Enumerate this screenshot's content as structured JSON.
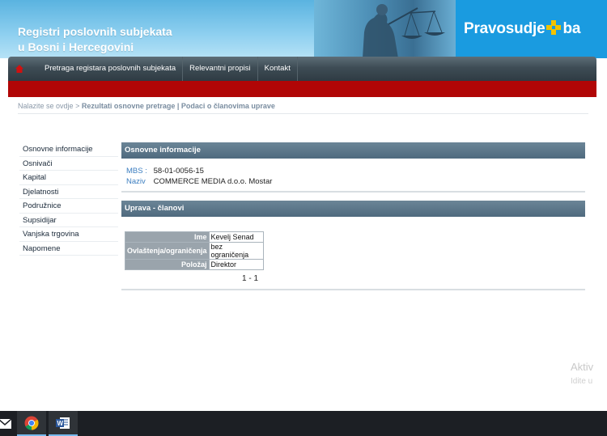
{
  "header": {
    "title_line1": "Registri poslovnih subjekata",
    "title_line2": "u Bosni i Hercegovini",
    "logo_left": "Pravosudje",
    "logo_right": "ba"
  },
  "nav": {
    "items": [
      {
        "label": "Pretraga registara poslovnih subjekata"
      },
      {
        "label": "Relevantni propisi"
      },
      {
        "label": "Kontakt"
      }
    ]
  },
  "breadcrumb": {
    "prefix": "Nalazite se ovdje",
    "separator": ">",
    "current": "Rezultati osnovne pretrage | Podaci o članovima uprave"
  },
  "sidebar": {
    "items": [
      {
        "label": "Osnovne informacije"
      },
      {
        "label": "Osnivači"
      },
      {
        "label": "Kapital"
      },
      {
        "label": "Djelatnosti"
      },
      {
        "label": "Podružnice"
      },
      {
        "label": "Supsidijar"
      },
      {
        "label": "Vanjska trgovina"
      },
      {
        "label": "Napomene"
      }
    ]
  },
  "basic_info": {
    "heading": "Osnovne informacije",
    "mbs_label": "MBS :",
    "mbs_value": "58-01-0056-15",
    "naziv_label": "Naziv",
    "naziv_value": "COMMERCE MEDIA d.o.o. Mostar"
  },
  "management": {
    "heading": "Uprava - članovi",
    "rows": [
      {
        "label": "Ime",
        "value": "Kevelj Senad"
      },
      {
        "label": "Ovlaštenja/ograničenja",
        "value": "bez ograničenja"
      },
      {
        "label": "Položaj",
        "value": "Direktor"
      }
    ],
    "pager": "1 - 1"
  },
  "watermark": {
    "line1": "Aktiv",
    "line2": "Idite u"
  },
  "taskbar": {
    "icons": [
      "mail-icon",
      "chrome-icon",
      "word-icon"
    ]
  },
  "colors": {
    "nav_bg": "#3e4c55",
    "red_bar": "#b10606",
    "logo_blue": "#1a9be0",
    "panel_head": "#5b7589",
    "link_blue": "#3c7ec0"
  }
}
